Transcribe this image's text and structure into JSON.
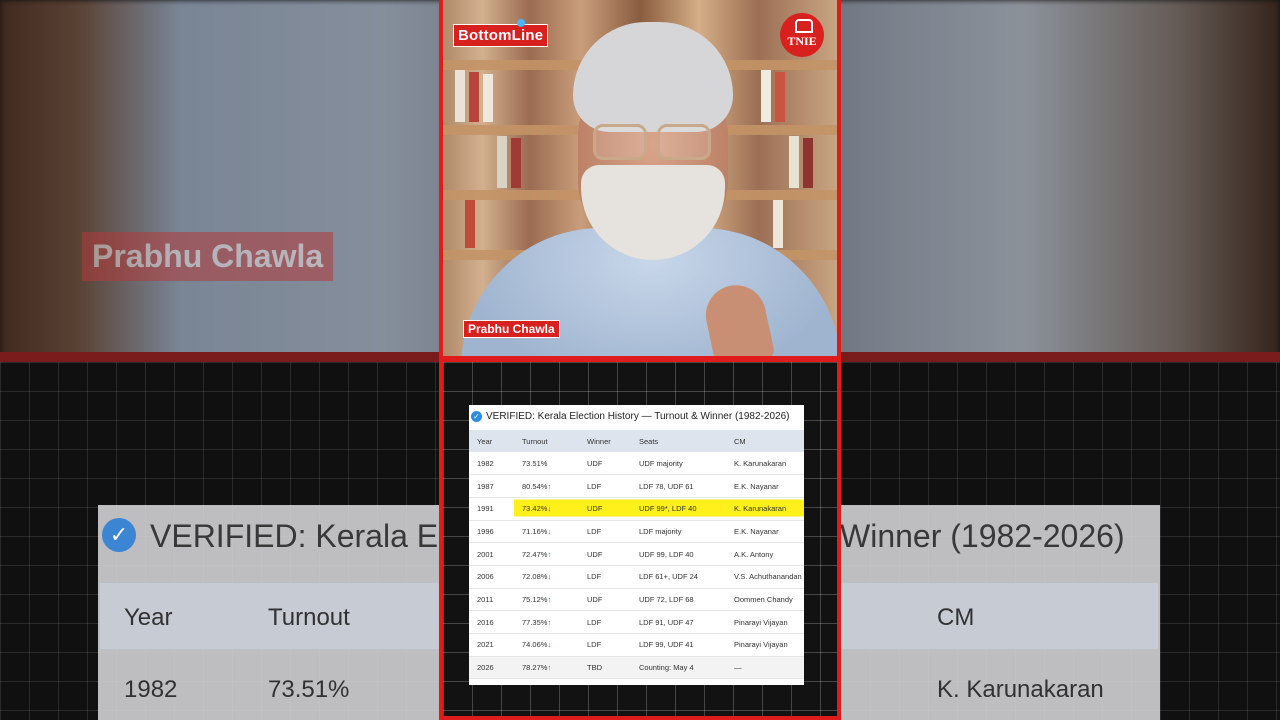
{
  "brand": {
    "show_logo": "BottomLine",
    "channel_logo": "TNIE"
  },
  "presenter": {
    "name": "Prabhu Chawla"
  },
  "table": {
    "title": "VERIFIED: Kerala Election History — Turnout & Winner (1982-2026)",
    "headers": [
      "Year",
      "Turnout",
      "Winner",
      "Seats",
      "CM"
    ],
    "rows": [
      {
        "year": "1982",
        "turnout": "73.51%",
        "trend": "",
        "winner": "UDF",
        "seats": "UDF majority",
        "cm": "K. Karunakaran",
        "highlight": false
      },
      {
        "year": "1987",
        "turnout": "80.54%",
        "trend": "↑",
        "winner": "LDF",
        "seats": "LDF 78, UDF 61",
        "cm": "E.K. Nayanar",
        "highlight": false
      },
      {
        "year": "1991",
        "turnout": "73.42%",
        "trend": "↓",
        "winner": "UDF",
        "seats": "UDF 99*, LDF 40",
        "cm": "K. Karunakaran",
        "highlight": true
      },
      {
        "year": "1996",
        "turnout": "71.16%",
        "trend": "↓",
        "winner": "LDF",
        "seats": "LDF majority",
        "cm": "E.K. Nayanar",
        "highlight": false
      },
      {
        "year": "2001",
        "turnout": "72.47%",
        "trend": "↑",
        "winner": "UDF",
        "seats": "UDF 99, LDF 40",
        "cm": "A.K. Antony",
        "highlight": false
      },
      {
        "year": "2006",
        "turnout": "72.08%",
        "trend": "↓",
        "winner": "LDF",
        "seats": "LDF 61+, UDF 24",
        "cm": "V.S. Achuthanandan",
        "highlight": false
      },
      {
        "year": "2011",
        "turnout": "75.12%",
        "trend": "↑",
        "winner": "UDF",
        "seats": "UDF 72, LDF 68",
        "cm": "Oommen Chandy",
        "highlight": false
      },
      {
        "year": "2016",
        "turnout": "77.35%",
        "trend": "↑",
        "winner": "LDF",
        "seats": "LDF 91, UDF 47",
        "cm": "Pinarayi Vijayan",
        "highlight": false
      },
      {
        "year": "2021",
        "turnout": "74.06%",
        "trend": "↓",
        "winner": "LDF",
        "seats": "LDF 99, UDF 41",
        "cm": "Pinarayi Vijayan",
        "highlight": false
      },
      {
        "year": "2026",
        "turnout": "78.27%",
        "trend": "↑",
        "winner": "TBD",
        "seats": "Counting: May 4",
        "cm": "—",
        "highlight": false
      }
    ]
  },
  "background_echo": {
    "title_left": "VERIFIED: Kerala Ele",
    "title_right": "Winner (1982-2026)",
    "col_year": "Year",
    "col_turnout": "Turnout",
    "col_cm": "CM",
    "row_year": "1982",
    "row_turnout": "73.51%",
    "row_cm": "K. Karunakaran"
  },
  "colors": {
    "accent_red": "#d8201f",
    "highlight_yellow": "#ffef1a",
    "trend_up": "#1b9e4b",
    "trend_down": "#d62828",
    "verified_blue": "#2d8ce0"
  }
}
